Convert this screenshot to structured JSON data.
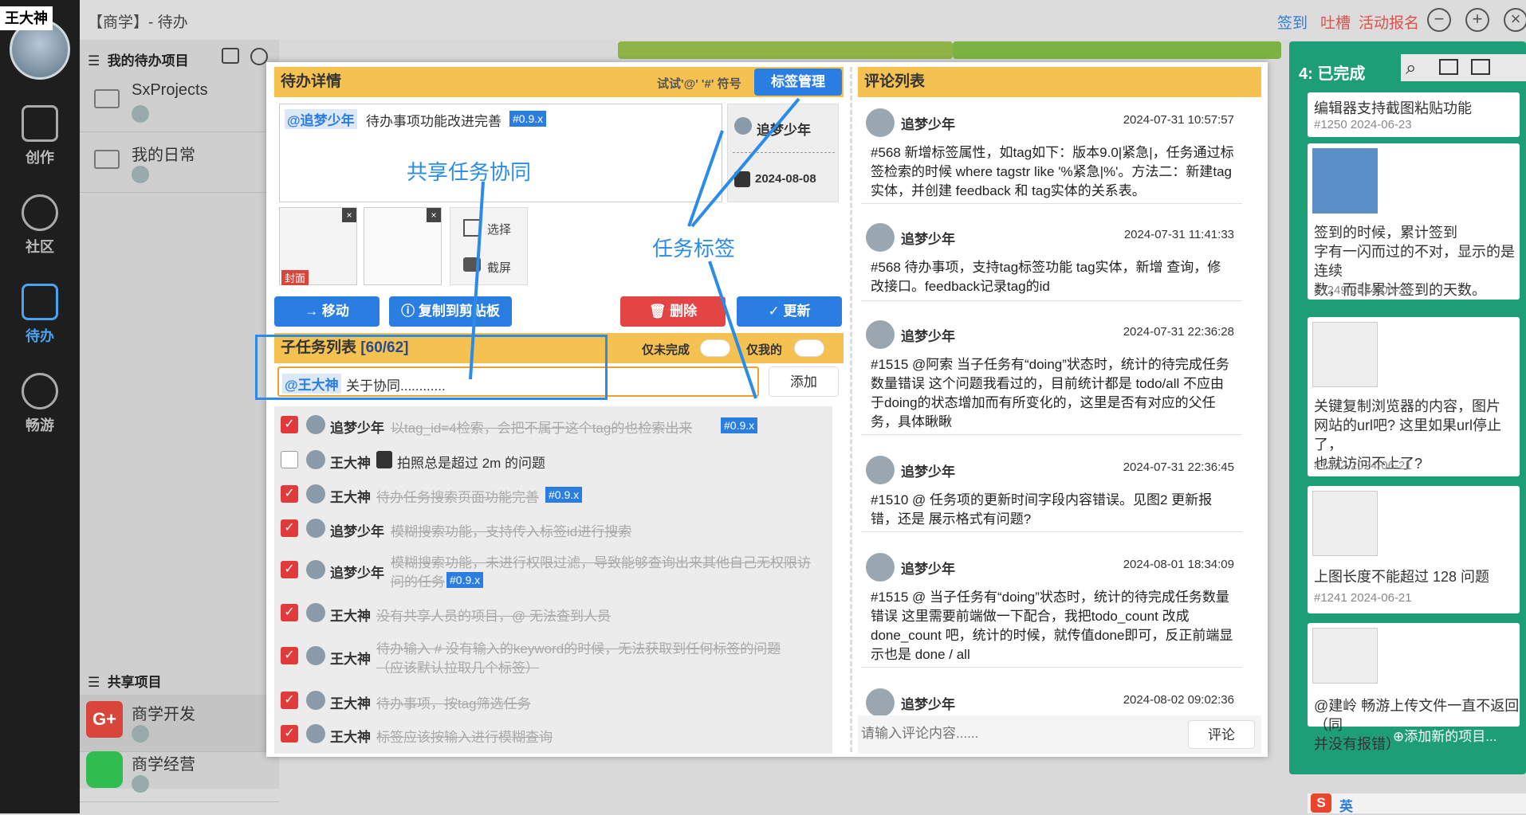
{
  "app": {
    "window_title": "【商学】- 待办",
    "user_name": "王大神"
  },
  "nav": [
    {
      "label": "创作"
    },
    {
      "label": "社区"
    },
    {
      "label": "待办"
    },
    {
      "label": "畅游"
    }
  ],
  "top_links": {
    "signin": "签到",
    "complain": "吐槽",
    "activity": "活动报名"
  },
  "sidebar": {
    "my_header": "我的待办项目",
    "my_projects": [
      {
        "name": "SxProjects"
      },
      {
        "name": "我的日常"
      }
    ],
    "shared_header": "共享项目",
    "shared_projects": [
      {
        "name": "商学开发"
      },
      {
        "name": "商学经营"
      }
    ]
  },
  "done_column": {
    "title": "4: 已完成",
    "add_label": "添加新的项目...",
    "cards": [
      {
        "title": "编辑器支持截图粘贴功能",
        "id": "#1250",
        "date": "2024-06-23"
      },
      {
        "title": "签到的时候，累计签到",
        "extra": "字有一闪而过的不对，显示的是连续",
        "extra2": "数，而非累计签到的天数。",
        "id": "#1249",
        "date": "2024-06-23"
      },
      {
        "title": "关键复制浏览器的内容，图片",
        "extra": "网站的url吧? 这里如果url停止了，",
        "extra2": "也就访问不上了?",
        "id": "#1242",
        "date": "2024-06-21"
      },
      {
        "title": "上图长度不能超过 128 问题",
        "id": "#1241",
        "date": "2024-06-21"
      },
      {
        "title": "@建岭 畅游上传文件一直不返回（同",
        "extra": "并没有报错）"
      }
    ]
  },
  "detail": {
    "header": "待办详情",
    "hint": "试试'@' '#' 符号",
    "tag_mgmt": "标签管理",
    "mention": "@追梦少年",
    "content": "待办事项功能改进完善",
    "version_tag": "#0.9.x",
    "owner": "追梦少年",
    "due_date": "2024-08-08",
    "cover_label": "封面",
    "select_label": "选择",
    "screenshot_label": "截屏",
    "buttons": {
      "move": "移动",
      "copy": "复制到剪贴板",
      "delete": "删除",
      "update": "更新"
    }
  },
  "subtasks": {
    "header": "子任务列表",
    "count": "[60/62]",
    "only_open": "仅未完成",
    "only_mine": "仅我的",
    "input_mention": "@王大神",
    "input_value": "关于协同............",
    "add": "添加",
    "items": [
      {
        "done": true,
        "user": "追梦少年",
        "text": "以tag_id=4检索，会把不属于这个tag的也检索出来",
        "tag": "#0.9.x"
      },
      {
        "done": false,
        "user": "王大神",
        "text": "拍照总是超过 2m 的问题",
        "tag": ""
      },
      {
        "done": true,
        "user": "王大神",
        "text": "待办任务搜索页面功能完善",
        "tag": "#0.9.x"
      },
      {
        "done": true,
        "user": "追梦少年",
        "text": "模糊搜索功能，支持传入标签id进行搜索",
        "tag": ""
      },
      {
        "done": true,
        "user": "追梦少年",
        "text": "模糊搜索功能，未进行权限过滤，导致能够查询出来其他自己无权限访",
        "text2": "问的任务",
        "tag": "#0.9.x"
      },
      {
        "done": true,
        "user": "王大神",
        "text": "没有共享人员的项目，@ 无法查到人员",
        "tag": ""
      },
      {
        "done": true,
        "user": "王大神",
        "text": "待办输入 # 没有输入的keyword的时候，无法获取到任何标签的问题",
        "text2": "（应该默认拉取几个标签）",
        "tag": ""
      },
      {
        "done": true,
        "user": "王大神",
        "text": "待办事项，按tag筛选任务",
        "tag": ""
      },
      {
        "done": true,
        "user": "王大神",
        "text": "标签应该按输入进行模糊查询",
        "tag": ""
      }
    ]
  },
  "comments": {
    "header": "评论列表",
    "placeholder": "请输入评论内容......",
    "submit": "评论",
    "items": [
      {
        "user": "追梦少年",
        "time": "2024-07-31 10:57:57",
        "text": "#568 新增标签属性，如tag如下：版本9.0|紧急|，任务通过标签检索的时候 where tagstr like '%紧急|%'。方法二：新建tag实体，并创建 feedback 和 tag实体的关系表。"
      },
      {
        "user": "追梦少年",
        "time": "2024-07-31 11:41:33",
        "text": "#568 待办事项，支持tag标签功能 tag实体，新增 查询，修改接口。feedback记录tag的id"
      },
      {
        "user": "追梦少年",
        "time": "2024-07-31 22:36:28",
        "text": "#1515 @阿索 当子任务有“doing”状态时，统计的待完成任务数量错误 这个问题我看过的，目前统计都是 todo/all 不应由于doing的状态增加而有所变化的，这里是否有对应的父任务，具体瞅瞅"
      },
      {
        "user": "追梦少年",
        "time": "2024-07-31 22:36:45",
        "text": "#1510 @ 任务项的更新时间字段内容错误。见图2 更新报错，还是 展示格式有问题?"
      },
      {
        "user": "追梦少年",
        "time": "2024-08-01 18:34:09",
        "text": "#1515 @ 当子任务有“doing”状态时，统计的待完成任务数量错误 这里需要前端做一下配合，我把todo_count 改成 done_count 吧，统计的时候，就传值done即可，反正前端显示也是 done / all"
      },
      {
        "user": "追梦少年",
        "time": "2024-08-02 09:02:36",
        "text": ""
      }
    ]
  },
  "annotations": {
    "share": "共享任务协同",
    "tags": "任务标签"
  },
  "ime": {
    "lang": "英"
  }
}
